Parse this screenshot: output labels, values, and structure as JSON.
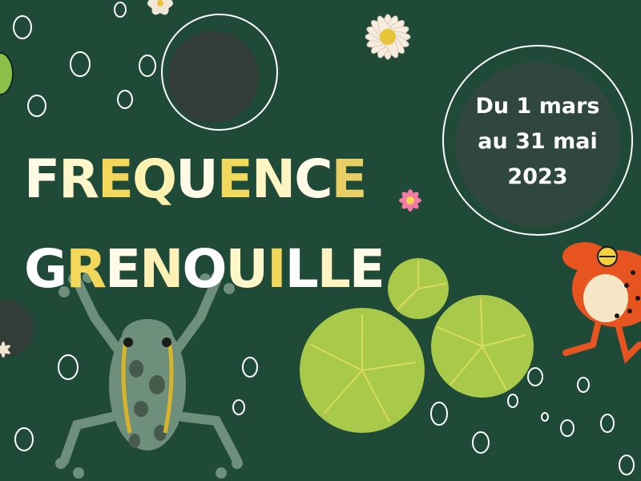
{
  "title": {
    "line1": [
      "F",
      "R",
      "E",
      "Q",
      "U",
      "E",
      "N",
      "C",
      "E"
    ],
    "line2": [
      "G",
      "R",
      "E",
      "N",
      "O",
      "U",
      "I",
      "L",
      "L",
      "E"
    ],
    "line1_colors": [
      "#fffbe6",
      "#fff6c9",
      "#f2d75a",
      "#fff2b0",
      "#fffbe6",
      "#f0d95c",
      "#fff5c4",
      "#fffbe6",
      "#e7cf66"
    ],
    "line2_colors": [
      "#ffffff",
      "#f2d75a",
      "#fffbe6",
      "#fff1b6",
      "#ffffff",
      "#fff6c9",
      "#f2d75a",
      "#ffffff",
      "#fff4c1",
      "#fffbe6"
    ]
  },
  "date_badge": {
    "line1": "Du 1 mars",
    "line2": "au 31 mai",
    "line3": "2023"
  },
  "colors": {
    "background": "#1f4a37",
    "badge_fill": "#2f473e",
    "badge_ring": "#ffffff",
    "lily_pad": "#a8c94a",
    "frog_gray": "#6f8f7d",
    "frog_yellow": "#d8b42a",
    "frog_orange": "#e8541f"
  }
}
